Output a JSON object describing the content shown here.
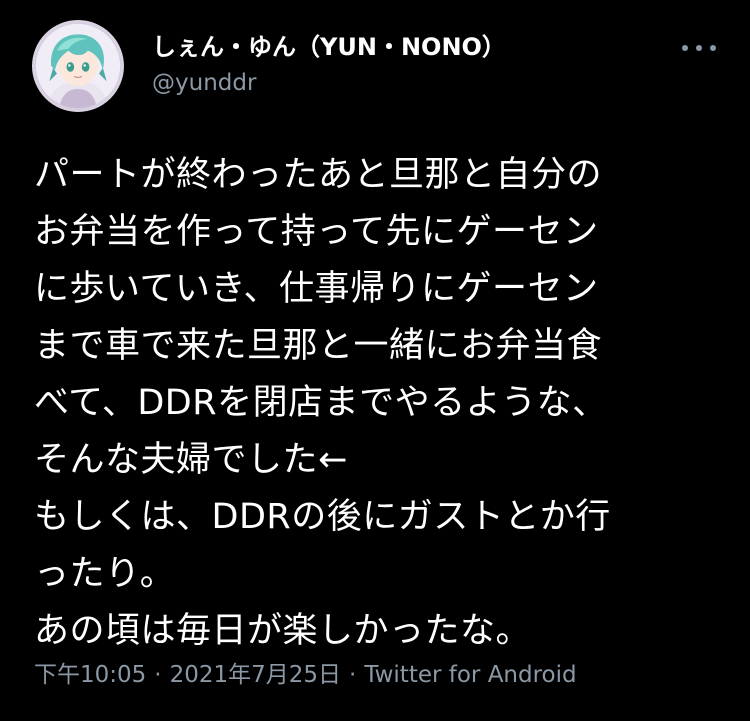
{
  "user": {
    "display_name": "しぇん・ゆん（YUN・NONO）",
    "handle": "@yunddr"
  },
  "tweet": {
    "lines": [
      "パートが終わったあと旦那と自分の",
      "お弁当を作って持って先にゲーセン",
      "に歩いていき、仕事帰りにゲーセン",
      "まで車で来た旦那と一緒にお弁当食",
      "べて、DDRを閉店までやるような、",
      "そんな夫婦でした←",
      "もしくは、DDRの後にガストとか行",
      "ったり。",
      "あの頃は毎日が楽しかったな。"
    ]
  },
  "meta": {
    "time": "下午10:05",
    "separator": "·",
    "date": "2021年7月25日",
    "source": "Twitter for Android"
  },
  "icons": {
    "more": "more-horizontal-icon",
    "avatar": "anime-avatar"
  },
  "colors": {
    "background": "#000000",
    "text": "#ffffff",
    "secondary": "#8b98a5"
  }
}
